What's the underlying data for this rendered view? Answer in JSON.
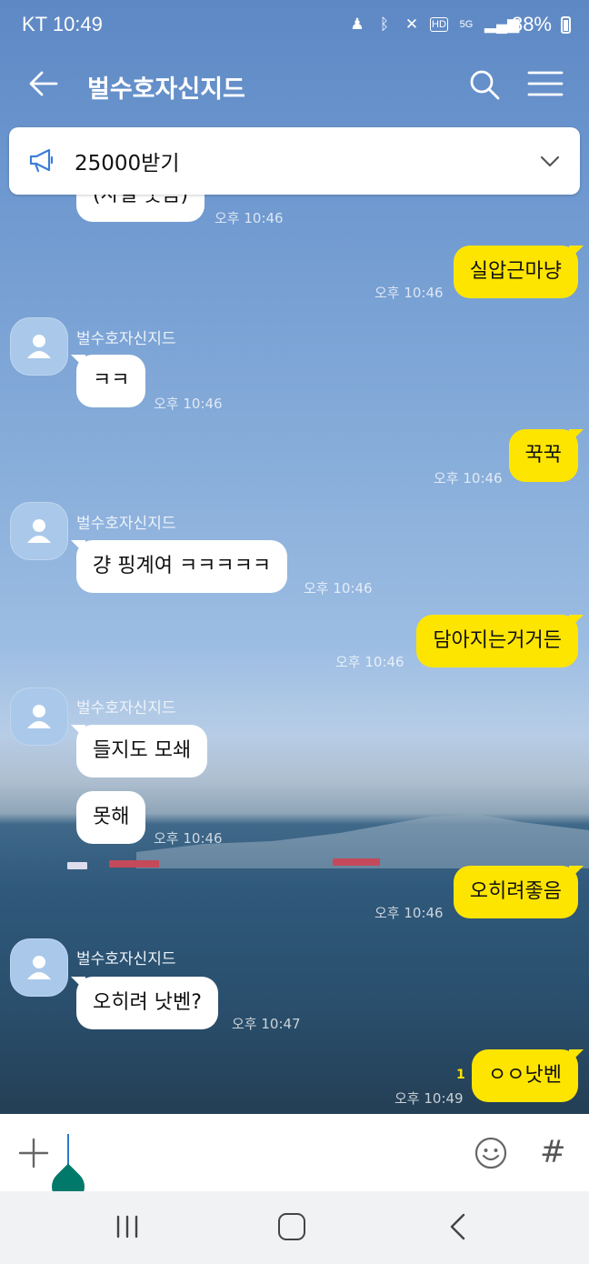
{
  "status": {
    "carrier_time": "KT 10:49",
    "net_label": "5G",
    "battery": "88%"
  },
  "header": {
    "title": "벌수호자신지드"
  },
  "notice": {
    "text": "25000받기"
  },
  "messages": [
    {
      "dir": "in",
      "text": "(사실 웃음)",
      "time": "오후 10:46"
    },
    {
      "dir": "out",
      "text": "실압근마냥",
      "time": "오후 10:46"
    },
    {
      "dir": "in",
      "sender": "벌수호자신지드",
      "text": "ㅋㅋ",
      "time": "오후 10:46"
    },
    {
      "dir": "out",
      "text": "꾹꾹",
      "time": "오후 10:46"
    },
    {
      "dir": "in",
      "sender": "벌수호자신지드",
      "text": "걍 핑계여 ㅋㅋㅋㅋㅋ",
      "time": "오후 10:46"
    },
    {
      "dir": "out",
      "text": "담아지는거거든",
      "time": "오후 10:46"
    },
    {
      "dir": "in",
      "sender": "벌수호자신지드",
      "text": "들지도 모쇄"
    },
    {
      "dir": "in",
      "text": "못해",
      "time": "오후 10:46"
    },
    {
      "dir": "out",
      "text": "오히려좋음",
      "time": "오후 10:46"
    },
    {
      "dir": "in",
      "sender": "벌수호자신지드",
      "text": "오히려 낫벤?",
      "time": "오후 10:47"
    },
    {
      "dir": "out",
      "text": "ㅇㅇ낫벤",
      "time": "오후 10:49",
      "unread": "1"
    }
  ],
  "input": {
    "plus_icon": "plus-icon",
    "emoji_icon": "emoji-icon",
    "hash": "#"
  },
  "colors": {
    "my_bubble": "#fee500",
    "their_bubble": "#ffffff",
    "cursor_handle": "#00796b"
  }
}
